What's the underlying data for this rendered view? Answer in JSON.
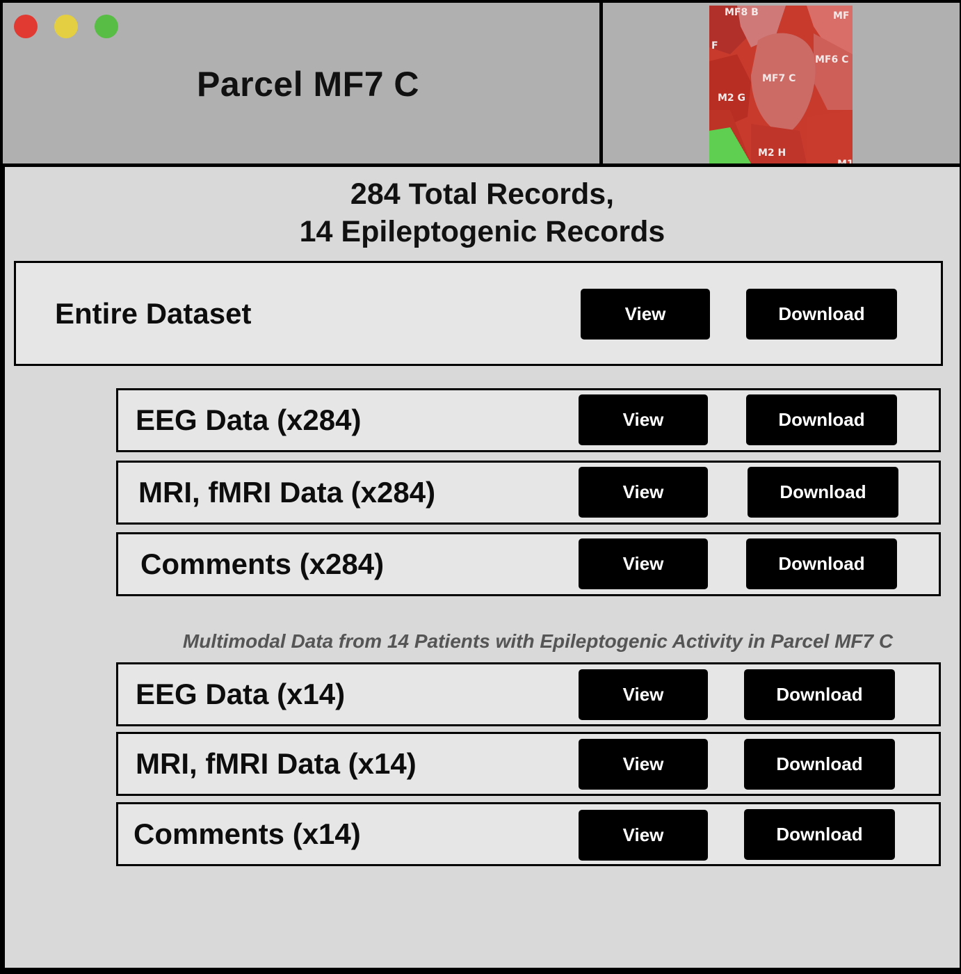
{
  "window": {
    "title": "Parcel MF7 C",
    "controls": {
      "close_color": "#e03a32",
      "minimize_color": "#e3cf41",
      "maximize_color": "#58bd45"
    }
  },
  "thumbnail": {
    "labels": [
      "MF8 B",
      "MF",
      "F",
      "MF6 C",
      "MF7 C",
      "M2 G",
      "M2 H",
      "M1"
    ]
  },
  "summary": {
    "line1": "284 Total Records,",
    "line2": "14 Epileptogenic Records"
  },
  "entire_dataset": {
    "label": "Entire Dataset",
    "view_label": "View",
    "download_label": "Download"
  },
  "all_records": [
    {
      "label": "EEG Data (x284)",
      "view_label": "View",
      "download_label": "Download"
    },
    {
      "label": "MRI, fMRI Data (x284)",
      "view_label": "View",
      "download_label": "Download"
    },
    {
      "label": "Comments (x284)",
      "view_label": "View",
      "download_label": "Download"
    }
  ],
  "epileptogenic_note": "Multimodal Data from 14 Patients with Epileptogenic Activity in Parcel MF7 C",
  "epileptogenic_records": [
    {
      "label": "EEG Data (x14)",
      "view_label": "View",
      "download_label": "Download"
    },
    {
      "label": "MRI, fMRI Data (x14)",
      "view_label": "View",
      "download_label": "Download"
    },
    {
      "label": "Comments (x14)",
      "view_label": "View",
      "download_label": "Download"
    }
  ],
  "colors": {
    "button_bg": "#000000",
    "panel_bg": "#e6e6e6",
    "window_bg": "#d9d9d9",
    "titlebar_bg": "#b0b0b0"
  }
}
